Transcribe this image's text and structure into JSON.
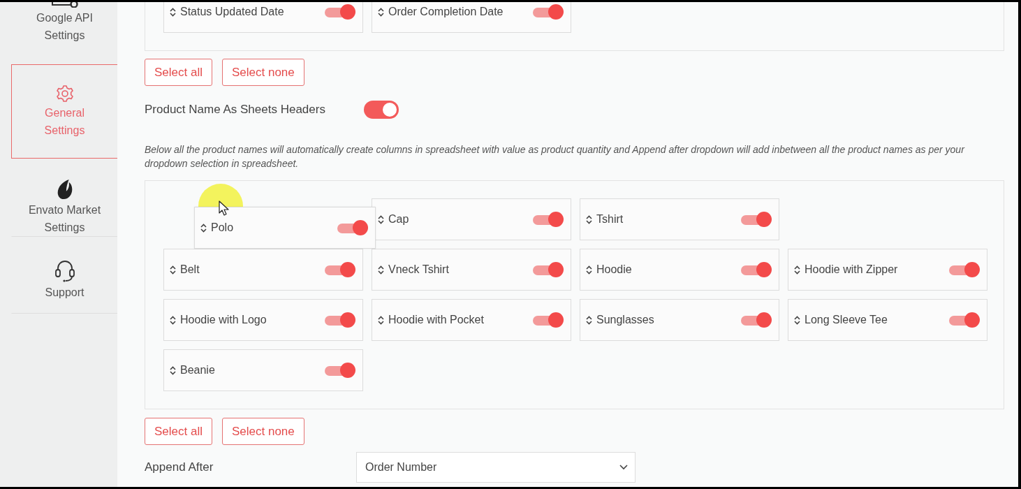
{
  "sidebar": {
    "items": [
      {
        "label": "Google API Settings",
        "selected": false
      },
      {
        "label": "General Settings",
        "selected": true
      },
      {
        "label": "Envato Market Settings",
        "selected": false
      },
      {
        "label": "Support",
        "selected": false
      }
    ]
  },
  "order_fields": {
    "items": [
      {
        "label": "Status Updated Date",
        "on": true
      },
      {
        "label": "Order Completion Date",
        "on": true
      }
    ],
    "buttons": [
      "Select all",
      "Select none"
    ]
  },
  "product_headers": {
    "label": "Product Name As Sheets Headers",
    "on": true
  },
  "description": "Below all the product names will automatically create columns in spreadsheet with value as product quantity and Append after dropdown will add inbetween all the product names as per your dropdown selection in spreadsheet.",
  "products": {
    "items": [
      {
        "kind": "drop-slot"
      },
      {
        "kind": "item",
        "label": "Cap",
        "on": true
      },
      {
        "kind": "item",
        "label": "Tshirt",
        "on": true
      },
      {
        "kind": "empty"
      },
      {
        "kind": "item",
        "label": "Belt",
        "on": true
      },
      {
        "kind": "item",
        "label": "Vneck Tshirt",
        "on": true
      },
      {
        "kind": "item",
        "label": "Hoodie",
        "on": true
      },
      {
        "kind": "item",
        "label": "Hoodie with Zipper",
        "on": true
      },
      {
        "kind": "item",
        "label": "Hoodie with Logo",
        "on": true
      },
      {
        "kind": "item",
        "label": "Hoodie with Pocket",
        "on": true
      },
      {
        "kind": "item",
        "label": "Sunglasses",
        "on": true
      },
      {
        "kind": "item",
        "label": "Long Sleeve Tee",
        "on": true
      },
      {
        "kind": "item",
        "label": "Beanie",
        "on": true
      }
    ],
    "dragged": {
      "label": "Polo",
      "on": true
    },
    "buttons": [
      "Select all",
      "Select none"
    ]
  },
  "append_after": {
    "label": "Append After",
    "value": "Order Number"
  }
}
